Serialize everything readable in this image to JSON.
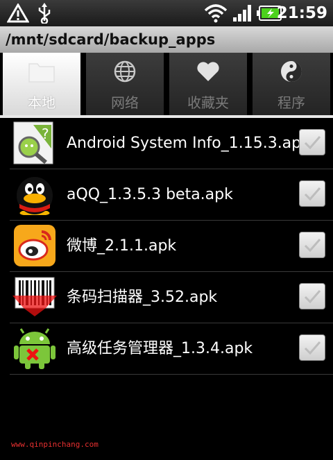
{
  "status": {
    "time": "21:59"
  },
  "path": "/mnt/sdcard/backup_apps",
  "tabs": [
    {
      "label": "本地",
      "icon": "folder-icon",
      "active": true
    },
    {
      "label": "网络",
      "icon": "globe-icon",
      "active": false
    },
    {
      "label": "收藏夹",
      "icon": "heart-icon",
      "active": false
    },
    {
      "label": "程序",
      "icon": "yin-yang-icon",
      "active": false
    }
  ],
  "files": [
    {
      "name": "Android System Info_1.15.3.apk",
      "icon": "android-system-info-icon"
    },
    {
      "name": "aQQ_1.3.5.3 beta.apk",
      "icon": "qq-penguin-icon"
    },
    {
      "name": "微博_2.1.1.apk",
      "icon": "weibo-icon"
    },
    {
      "name": "条码扫描器_3.52.apk",
      "icon": "barcode-scanner-icon"
    },
    {
      "name": "高级任务管理器_1.3.4.apk",
      "icon": "task-manager-icon"
    }
  ],
  "footer": "www.qinpinchang.com",
  "colors": {
    "pathbar": "#c0c0c0",
    "watermark": "#e83030"
  }
}
